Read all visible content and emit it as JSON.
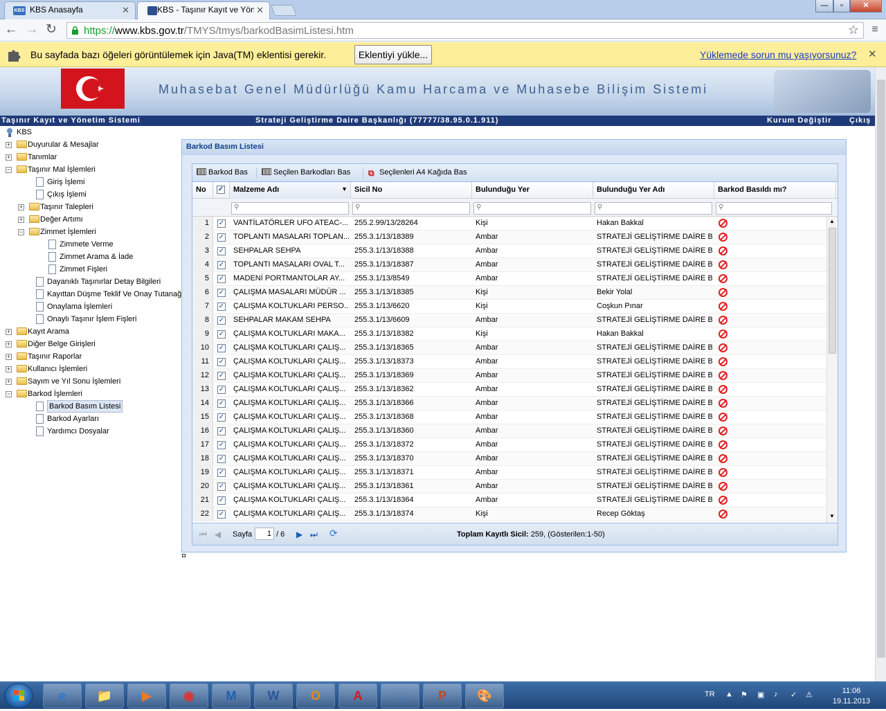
{
  "tabs": [
    {
      "title": "KBS Anasayfa",
      "favicon": "KBS"
    },
    {
      "title": "KBS - Taşınır Kayıt ve Yöne",
      "favicon": "KBS"
    }
  ],
  "window_buttons": [
    "—",
    "▫",
    "✕"
  ],
  "address": {
    "scheme": "https://",
    "host": "www.kbs.gov.tr",
    "path": "/TMYS/tmys/barkodBasimListesi.htm"
  },
  "infobar": {
    "message": "Bu sayfada bazı öğeleri görüntülemek için Java(TM) eklentisi gerekir.",
    "button": "Eklentiyi yükle...",
    "link": "Yüklemede sorun mu yaşıyorsunuz?"
  },
  "banner": {
    "title": "Muhasebat Genel Müdürlüğü Kamu Harcama ve Muhasebe Bilişim Sistemi"
  },
  "statusbar": {
    "left": "Taşınır Kayıt ve Yönetim Sistemi",
    "center": "Strateji Geliştirme Daire Başkanlığı (77777/38.95.0.1.911)",
    "change": "Kurum Değiştir",
    "logout": "Çıkış"
  },
  "tree": {
    "root": "KBS",
    "items": [
      {
        "label": "Duyurular & Mesajlar",
        "type": "folder",
        "level": 0,
        "expanded": false
      },
      {
        "label": "Tanımlar",
        "type": "folder",
        "level": 0,
        "expanded": false
      },
      {
        "label": "Taşınır Mal İşlemleri",
        "type": "folder",
        "level": 0,
        "expanded": true
      },
      {
        "label": "Giriş İşlemi",
        "type": "page",
        "level": 1
      },
      {
        "label": "Çıkış İşlemi",
        "type": "page",
        "level": 1
      },
      {
        "label": "Taşınır Talepleri",
        "type": "folder",
        "level": 1,
        "expanded": false
      },
      {
        "label": "Değer Artımı",
        "type": "folder",
        "level": 1,
        "expanded": false
      },
      {
        "label": "Zimmet İşlemleri",
        "type": "folder",
        "level": 1,
        "expanded": true
      },
      {
        "label": "Zimmete Verme",
        "type": "page",
        "level": 2
      },
      {
        "label": "Zimmet Arama & İade",
        "type": "page",
        "level": 2
      },
      {
        "label": "Zimmet Fişleri",
        "type": "page",
        "level": 2
      },
      {
        "label": "Dayanıklı Taşınırlar Detay Bilgileri",
        "type": "page",
        "level": 1
      },
      {
        "label": "Kayıttan Düşme Teklif Ve Onay Tutanağı",
        "type": "page",
        "level": 1
      },
      {
        "label": "Onaylama İşlemleri",
        "type": "page",
        "level": 1
      },
      {
        "label": "Onaylı Taşınır İşlem Fişleri",
        "type": "page",
        "level": 1
      },
      {
        "label": "Kayıt Arama",
        "type": "folder",
        "level": 0,
        "expanded": false
      },
      {
        "label": "Diğer Belge Girişleri",
        "type": "folder",
        "level": 0,
        "expanded": false
      },
      {
        "label": "Taşınır Raporlar",
        "type": "folder",
        "level": 0,
        "expanded": false
      },
      {
        "label": "Kullanıcı İşlemleri",
        "type": "folder",
        "level": 0,
        "expanded": false
      },
      {
        "label": "Sayım ve Yıl Sonu İşlemleri",
        "type": "folder",
        "level": 0,
        "expanded": false
      },
      {
        "label": "Barkod İşlemleri",
        "type": "folder",
        "level": 0,
        "expanded": true
      },
      {
        "label": "Barkod Basım Listesi",
        "type": "page",
        "level": 1,
        "selected": true
      },
      {
        "label": "Barkod Ayarları",
        "type": "page",
        "level": 1
      },
      {
        "label": "Yardımcı Dosyalar",
        "type": "page",
        "level": 1
      }
    ]
  },
  "panel": {
    "title": "Barkod Basım Listesi"
  },
  "grid": {
    "toolbar": [
      "Barkod Bas",
      "Seçilen Barkodları Bas",
      "Seçilenleri A4 Kağıda Bas"
    ],
    "columns": [
      "No",
      "",
      "Malzeme Adı",
      "Sicil No",
      "Bulunduğu Yer",
      "Bulunduğu Yer Adı",
      "Barkod Basıldı mı?"
    ],
    "filter_placeholder": "⚲",
    "rows": [
      {
        "no": "1",
        "name": "VANTİLATÖRLER UFO ATEAC-...",
        "sicil": "255.2.99/13/28264",
        "yer": "Kişi",
        "yer_adi": "Hakan Bakkal"
      },
      {
        "no": "2",
        "name": "TOPLANTI MASALARI TOPLAN...",
        "sicil": "255.3.1/13/18389",
        "yer": "Ambar",
        "yer_adi": "STRATEJİ GELİŞTİRME DAİRE B..."
      },
      {
        "no": "3",
        "name": "SEHPALAR SEHPA",
        "sicil": "255.3.1/13/18388",
        "yer": "Ambar",
        "yer_adi": "STRATEJİ GELİŞTİRME DAİRE B..."
      },
      {
        "no": "4",
        "name": "TOPLANTI MASALARI OVAL T...",
        "sicil": "255.3.1/13/18387",
        "yer": "Ambar",
        "yer_adi": "STRATEJİ GELİŞTİRME DAİRE B..."
      },
      {
        "no": "5",
        "name": "MADENİ PORTMANTOLAR AY...",
        "sicil": "255.3.1/13/8549",
        "yer": "Ambar",
        "yer_adi": "STRATEJİ GELİŞTİRME DAİRE B..."
      },
      {
        "no": "6",
        "name": "ÇALIŞMA MASALARI MÜDÜR ...",
        "sicil": "255.3.1/13/18385",
        "yer": "Kişi",
        "yer_adi": "Bekir Yolal"
      },
      {
        "no": "7",
        "name": "ÇALIŞMA KOLTUKLARI PERSO...",
        "sicil": "255.3.1/13/6620",
        "yer": "Kişi",
        "yer_adi": "Coşkun Pınar"
      },
      {
        "no": "8",
        "name": "SEHPALAR MAKAM SEHPA",
        "sicil": "255.3.1/13/6609",
        "yer": "Ambar",
        "yer_adi": "STRATEJİ GELİŞTİRME DAİRE B..."
      },
      {
        "no": "9",
        "name": "ÇALIŞMA KOLTUKLARI MAKA...",
        "sicil": "255.3.1/13/18382",
        "yer": "Kişi",
        "yer_adi": "Hakan Bakkal"
      },
      {
        "no": "10",
        "name": "ÇALIŞMA KOLTUKLARI ÇALIŞ...",
        "sicil": "255.3.1/13/18365",
        "yer": "Ambar",
        "yer_adi": "STRATEJİ GELİŞTİRME DAİRE B..."
      },
      {
        "no": "11",
        "name": "ÇALIŞMA KOLTUKLARI ÇALIŞ...",
        "sicil": "255.3.1/13/18373",
        "yer": "Ambar",
        "yer_adi": "STRATEJİ GELİŞTİRME DAİRE B..."
      },
      {
        "no": "12",
        "name": "ÇALIŞMA KOLTUKLARI ÇALIŞ...",
        "sicil": "255.3.1/13/18369",
        "yer": "Ambar",
        "yer_adi": "STRATEJİ GELİŞTİRME DAİRE B..."
      },
      {
        "no": "13",
        "name": "ÇALIŞMA KOLTUKLARI ÇALIŞ...",
        "sicil": "255.3.1/13/18362",
        "yer": "Ambar",
        "yer_adi": "STRATEJİ GELİŞTİRME DAİRE B..."
      },
      {
        "no": "14",
        "name": "ÇALIŞMA KOLTUKLARI ÇALIŞ...",
        "sicil": "255.3.1/13/18366",
        "yer": "Ambar",
        "yer_adi": "STRATEJİ GELİŞTİRME DAİRE B..."
      },
      {
        "no": "15",
        "name": "ÇALIŞMA KOLTUKLARI ÇALIŞ...",
        "sicil": "255.3.1/13/18368",
        "yer": "Ambar",
        "yer_adi": "STRATEJİ GELİŞTİRME DAİRE B..."
      },
      {
        "no": "16",
        "name": "ÇALIŞMA KOLTUKLARI ÇALIŞ...",
        "sicil": "255.3.1/13/18360",
        "yer": "Ambar",
        "yer_adi": "STRATEJİ GELİŞTİRME DAİRE B..."
      },
      {
        "no": "17",
        "name": "ÇALIŞMA KOLTUKLARI ÇALIŞ...",
        "sicil": "255.3.1/13/18372",
        "yer": "Ambar",
        "yer_adi": "STRATEJİ GELİŞTİRME DAİRE B..."
      },
      {
        "no": "18",
        "name": "ÇALIŞMA KOLTUKLARI ÇALIŞ...",
        "sicil": "255.3.1/13/18370",
        "yer": "Ambar",
        "yer_adi": "STRATEJİ GELİŞTİRME DAİRE B..."
      },
      {
        "no": "19",
        "name": "ÇALIŞMA KOLTUKLARI ÇALIŞ...",
        "sicil": "255.3.1/13/18371",
        "yer": "Ambar",
        "yer_adi": "STRATEJİ GELİŞTİRME DAİRE B..."
      },
      {
        "no": "20",
        "name": "ÇALIŞMA KOLTUKLARI ÇALIŞ...",
        "sicil": "255.3.1/13/18361",
        "yer": "Ambar",
        "yer_adi": "STRATEJİ GELİŞTİRME DAİRE B..."
      },
      {
        "no": "21",
        "name": "ÇALIŞMA KOLTUKLARI ÇALIŞ...",
        "sicil": "255.3.1/13/18364",
        "yer": "Ambar",
        "yer_adi": "STRATEJİ GELİŞTİRME DAİRE B..."
      },
      {
        "no": "22",
        "name": "ÇALIŞMA KOLTUKLARI ÇALIŞ...",
        "sicil": "255.3.1/13/18374",
        "yer": "Kişi",
        "yer_adi": "Recep Göktaş"
      }
    ],
    "footer": {
      "page_label": "Sayfa",
      "page_value": "1",
      "page_total": "/ 6",
      "summary_label": "Toplam Kayıtlı Sicil:",
      "summary_value": "259, (Gösterilen:1-50)"
    }
  },
  "taskbar": {
    "apps": [
      "e",
      "📁",
      "▶",
      "◉",
      "M",
      "W",
      "O",
      "A",
      "↓",
      "P",
      "🎨"
    ],
    "lang": "TR",
    "time": "11:06",
    "date": "19.11.2013"
  },
  "colors": {
    "accent": "#15428b",
    "statusbar": "#1f3a78",
    "infobar": "#fdee9a",
    "not_printed": "#e02020"
  }
}
